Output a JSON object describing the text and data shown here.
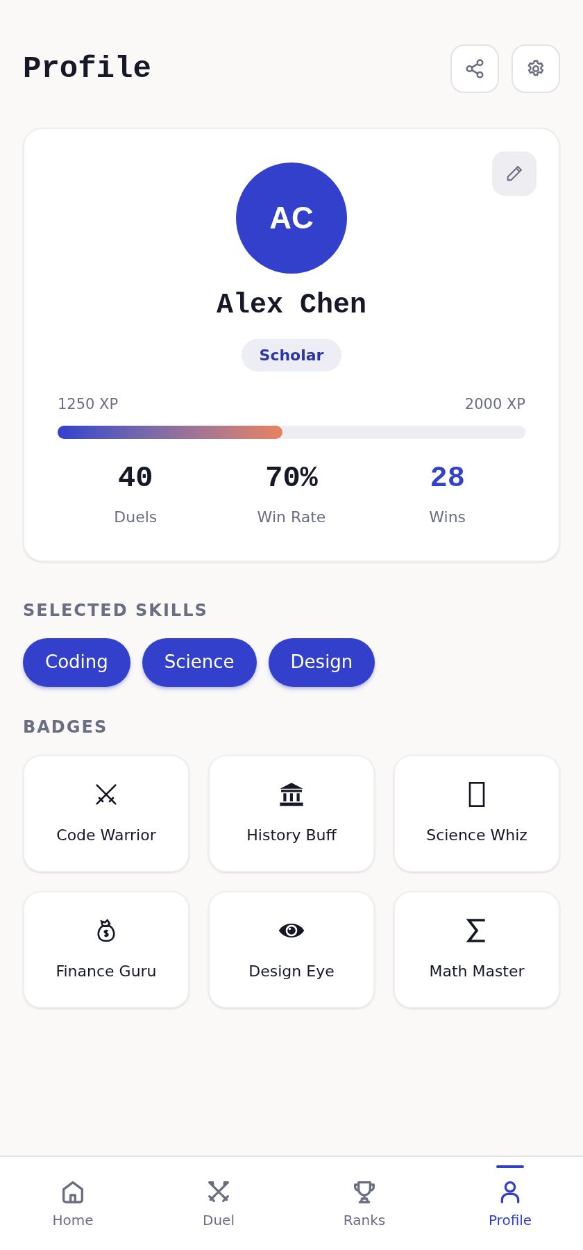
{
  "header": {
    "title": "Profile"
  },
  "profile": {
    "initials": "AC",
    "name": "Alex Chen",
    "rank": "Scholar",
    "xp_current": "1250 XP",
    "xp_next": "2000 XP",
    "level": 0.48,
    "stats": [
      {
        "value": "40",
        "label": "Duels",
        "highlight": false
      },
      {
        "value": "70%",
        "label": "Win Rate",
        "highlight": false
      },
      {
        "value": "28",
        "label": "Wins",
        "highlight": true
      }
    ]
  },
  "skills": {
    "heading": "SELECTED SKILLS",
    "items": [
      "Coding",
      "Science",
      "Design"
    ]
  },
  "badges": {
    "heading": "BADGES",
    "items": [
      {
        "label": "Code Warrior"
      },
      {
        "label": "History Buff"
      },
      {
        "label": "Science Whiz"
      },
      {
        "label": "Finance Guru"
      },
      {
        "label": "Design Eye"
      },
      {
        "label": "Math Master"
      }
    ]
  },
  "nav": [
    {
      "label": "Home",
      "selected": false
    },
    {
      "label": "Duel",
      "selected": false
    },
    {
      "label": "Ranks",
      "selected": false
    },
    {
      "label": "Profile",
      "selected": true
    }
  ]
}
